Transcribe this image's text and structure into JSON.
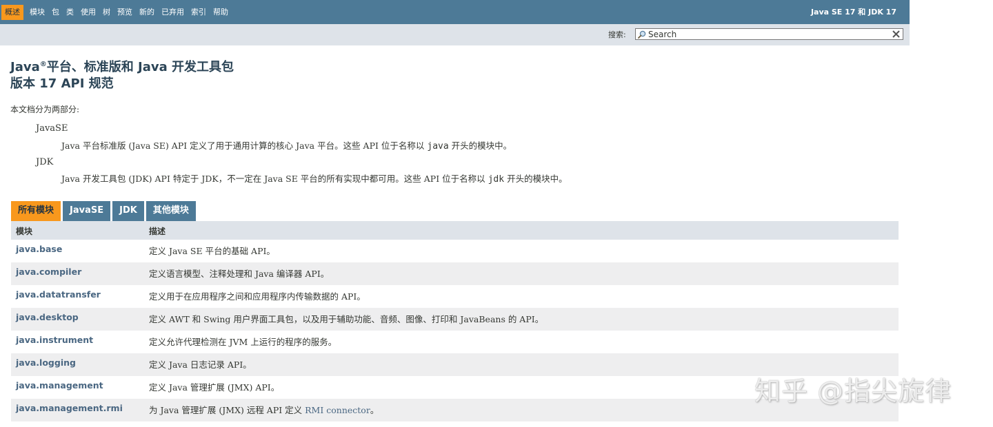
{
  "nav": {
    "items": [
      "概述",
      "模块",
      "包",
      "类",
      "使用",
      "树",
      "预览",
      "新的",
      "已弃用",
      "索引",
      "帮助"
    ],
    "active_index": 0,
    "about": "Java SE 17 和 JDK 17"
  },
  "search": {
    "label": "搜索:",
    "placeholder": "Search"
  },
  "header": {
    "title_line1_a": "Java",
    "title_sup": "®",
    "title_line1_b": "平台、标准版和 Java 开发工具包",
    "title_line2": "版本 17 API 规范"
  },
  "intro": {
    "lead": "本文档分为两部分:",
    "javase_term": "JavaSE",
    "javase_desc_pre": "Java 平台标准版 (Java SE) API 定义了用于通用计算的核心 Java 平台。这些 API 位于名称以 ",
    "javase_code": "java",
    "javase_desc_post": " 开头的模块中。",
    "jdk_term": "JDK",
    "jdk_desc_pre": "Java 开发工具包 (JDK) API 特定于 JDK，不一定在 Java SE 平台的所有实现中都可用。这些 API 位于名称以 ",
    "jdk_code": "jdk",
    "jdk_desc_post": " 开头的模块中。"
  },
  "tabs": [
    "所有模块",
    "JavaSE",
    "JDK",
    "其他模块"
  ],
  "table": {
    "columns": [
      "模块",
      "描述"
    ],
    "rows": [
      {
        "module": "java.base",
        "desc": "定义 Java SE 平台的基础 API。"
      },
      {
        "module": "java.compiler",
        "desc": "定义语言模型、注释处理和 Java 编译器 API。"
      },
      {
        "module": "java.datatransfer",
        "desc": "定义用于在应用程序之间和应用程序内传输数据的 API。"
      },
      {
        "module": "java.desktop",
        "desc": "定义 AWT 和 Swing 用户界面工具包，以及用于辅助功能、音频、图像、打印和 JavaBeans 的 API。"
      },
      {
        "module": "java.instrument",
        "desc": "定义允许代理检测在 JVM 上运行的程序的服务。"
      },
      {
        "module": "java.logging",
        "desc": "定义 Java 日志记录 API。"
      },
      {
        "module": "java.management",
        "desc": "定义 Java 管理扩展 (JMX) API。"
      },
      {
        "module": "java.management.rmi",
        "desc_pre": "为 Java 管理扩展 (JMX) 远程 API 定义 ",
        "desc_link": "RMI connector",
        "desc_post": "。"
      }
    ]
  },
  "watermark": "知乎 @指尖旋律",
  "colors": {
    "nav_bg": "#4d7a97",
    "accent": "#f8981d",
    "subnav_bg": "#dee3e9",
    "row_alt": "#eeeeef",
    "link": "#4a6782",
    "title": "#2c4557"
  }
}
